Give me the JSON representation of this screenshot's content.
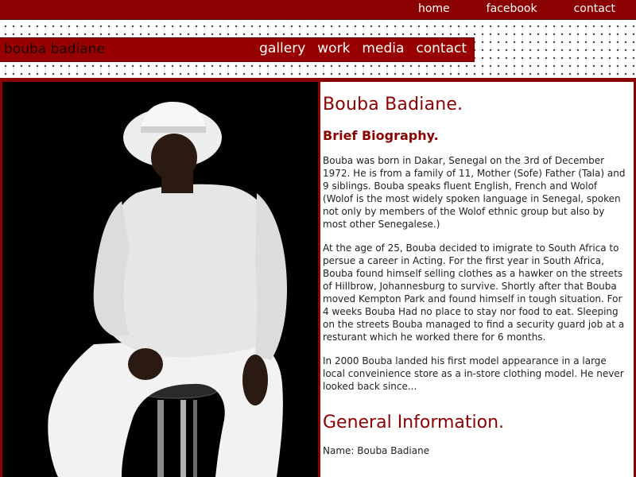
{
  "top_nav": {
    "home": "home",
    "facebook": "facebook",
    "contact": "contact"
  },
  "header": {
    "site_title": "bouba badiane"
  },
  "main_nav": {
    "gallery": "gallery",
    "work": "work",
    "media": "media",
    "contact": "contact"
  },
  "content": {
    "name_heading": "Bouba Badiane.",
    "bio_heading": "Brief Biography.",
    "paragraphs": [
      "Bouba was born in Dakar, Senegal on the 3rd of December 1972. He is from a family of 11, Mother (Sofe) Father (Tala) and 9 siblings. Bouba speaks fluent English, French and Wolof (Wolof is the most widely spoken language in Senegal, spoken not only by members of the Wolof ethnic group but also by most other Senegalese.)",
      "At the age of 25, Bouba decided to imigrate to South Africa to persue a career in Acting. For the first year in South Africa, Bouba found himself selling clothes as a hawker on the streets of Hillbrow, Johannesburg to survive. Shortly after that Bouba moved Kempton Park and found himself in tough situation. For 4 weeks Bouba Had no place to stay nor food to eat. Sleeping on the streets Bouba managed to find a security guard job at a resturant which he worked there for 6 months.",
      "In 2000 Bouba landed his first model appearance in a large local conveinience store as a in-store clothing model. He never looked back since..."
    ],
    "general_heading": "General Information.",
    "cut_off_line": "Name: Bouba Badiane"
  },
  "colors": {
    "brand_red": "#8b0000",
    "title_bar_red": "#980000",
    "photo_background": "#000000"
  }
}
